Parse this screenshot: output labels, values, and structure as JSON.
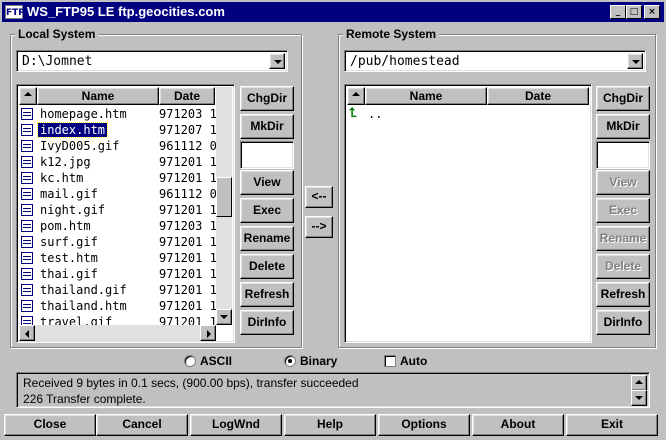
{
  "window": {
    "title": "WS_FTP95 LE ftp.geocities.com",
    "app_icon_text": "FTP",
    "minimize": "_",
    "maximize": "□",
    "close": "×"
  },
  "local": {
    "label": "Local System",
    "path": "D:\\Jomnet",
    "columns": {
      "name": "Name",
      "date": "Date"
    },
    "files": [
      {
        "name": "homepage.htm",
        "date": "971203 1"
      },
      {
        "name": "index.htm",
        "date": "971207 1",
        "selected": true
      },
      {
        "name": "IvyD005.gif",
        "date": "961112 0"
      },
      {
        "name": "k12.jpg",
        "date": "971201 1"
      },
      {
        "name": "kc.htm",
        "date": "971201 1"
      },
      {
        "name": "mail.gif",
        "date": "961112 0"
      },
      {
        "name": "night.gif",
        "date": "971201 1"
      },
      {
        "name": "pom.htm",
        "date": "971203 1"
      },
      {
        "name": "surf.gif",
        "date": "971201 1"
      },
      {
        "name": "test.htm",
        "date": "971201 1"
      },
      {
        "name": "thai.gif",
        "date": "971201 1"
      },
      {
        "name": "thailand.gif",
        "date": "971201 1"
      },
      {
        "name": "thailand.htm",
        "date": "971201 1"
      },
      {
        "name": "travel.gif",
        "date": "971201 1"
      }
    ],
    "buttons": [
      "ChgDir",
      "MkDir",
      "View",
      "Exec",
      "Rename",
      "Delete",
      "Refresh",
      "DirInfo"
    ]
  },
  "transfer": {
    "to_local": "<--",
    "to_remote": "-->"
  },
  "remote": {
    "label": "Remote System",
    "path": "/pub/homestead",
    "columns": {
      "name": "Name",
      "date": "Date"
    },
    "entries": [
      {
        "name": ".."
      }
    ],
    "buttons": [
      {
        "label": "ChgDir",
        "enabled": true
      },
      {
        "label": "MkDir",
        "enabled": true
      },
      {
        "label": "View",
        "enabled": false
      },
      {
        "label": "Exec",
        "enabled": false
      },
      {
        "label": "Rename",
        "enabled": false
      },
      {
        "label": "Delete",
        "enabled": false
      },
      {
        "label": "Refresh",
        "enabled": true
      },
      {
        "label": "DirInfo",
        "enabled": true
      }
    ]
  },
  "mode": {
    "ascii": "ASCII",
    "binary": "Binary",
    "auto": "Auto",
    "selected": "Binary",
    "auto_checked": false
  },
  "status": {
    "line1": "Received 9 bytes in 0.1 secs, (900.00 bps), transfer succeeded",
    "line2": "226 Transfer complete."
  },
  "bottom_buttons": [
    "Close",
    "Cancel",
    "LogWnd",
    "Help",
    "Options",
    "About",
    "Exit"
  ]
}
